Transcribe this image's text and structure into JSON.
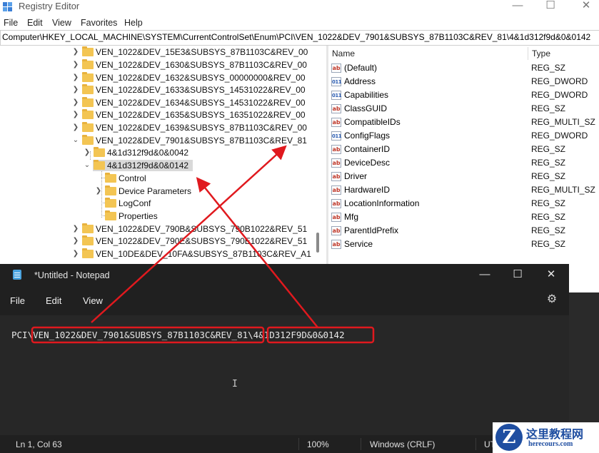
{
  "regedit": {
    "title": "Registry Editor",
    "menu": [
      "File",
      "Edit",
      "View",
      "Favorites",
      "Help"
    ],
    "address": "Computer\\HKEY_LOCAL_MACHINE\\SYSTEM\\CurrentControlSet\\Enum\\PCI\\VEN_1022&DEV_7901&SUBSYS_87B1103C&REV_81\\4&1d312f9d&0&0142",
    "tree": [
      "VEN_1022&DEV_15E3&SUBSYS_87B1103C&REV_00",
      "VEN_1022&DEV_1630&SUBSYS_87B1103C&REV_00",
      "VEN_1022&DEV_1632&SUBSYS_00000000&REV_00",
      "VEN_1022&DEV_1633&SUBSYS_14531022&REV_00",
      "VEN_1022&DEV_1634&SUBSYS_14531022&REV_00",
      "VEN_1022&DEV_1635&SUBSYS_16351022&REV_00",
      "VEN_1022&DEV_1639&SUBSYS_87B1103C&REV_00",
      "VEN_1022&DEV_7901&SUBSYS_87B1103C&REV_81",
      "4&1d312f9d&0&0042",
      "4&1d312f9d&0&0142",
      "Control",
      "Device Parameters",
      "LogConf",
      "Properties",
      "VEN_1022&DEV_790B&SUBSYS_790B1022&REV_51",
      "VEN_1022&DEV_790E&SUBSYS_790E1022&REV_51",
      "VEN_10DE&DEV_10FA&SUBSYS_87B1103C&REV_A1"
    ],
    "columns": {
      "name": "Name",
      "type": "Type"
    },
    "values": [
      {
        "name": "(Default)",
        "type": "REG_SZ",
        "icon": "string-value-icon"
      },
      {
        "name": "Address",
        "type": "REG_DWORD",
        "icon": "binary-value-icon"
      },
      {
        "name": "Capabilities",
        "type": "REG_DWORD",
        "icon": "binary-value-icon"
      },
      {
        "name": "ClassGUID",
        "type": "REG_SZ",
        "icon": "string-value-icon"
      },
      {
        "name": "CompatibleIDs",
        "type": "REG_MULTI_SZ",
        "icon": "string-value-icon"
      },
      {
        "name": "ConfigFlags",
        "type": "REG_DWORD",
        "icon": "binary-value-icon"
      },
      {
        "name": "ContainerID",
        "type": "REG_SZ",
        "icon": "string-value-icon"
      },
      {
        "name": "DeviceDesc",
        "type": "REG_SZ",
        "icon": "string-value-icon"
      },
      {
        "name": "Driver",
        "type": "REG_SZ",
        "icon": "string-value-icon"
      },
      {
        "name": "HardwareID",
        "type": "REG_MULTI_SZ",
        "icon": "string-value-icon"
      },
      {
        "name": "LocationInformation",
        "type": "REG_SZ",
        "icon": "string-value-icon"
      },
      {
        "name": "Mfg",
        "type": "REG_SZ",
        "icon": "string-value-icon"
      },
      {
        "name": "ParentIdPrefix",
        "type": "REG_SZ",
        "icon": "string-value-icon"
      },
      {
        "name": "Service",
        "type": "REG_SZ",
        "icon": "string-value-icon"
      }
    ]
  },
  "notepad": {
    "title": "*Untitled - Notepad",
    "menu": [
      "File",
      "Edit",
      "View"
    ],
    "text_prefix": "PCI\\",
    "text_device": "VEN_1022&DEV_7901&SUBSYS_87B1103C&REV_81",
    "text_sep": "\\",
    "text_instance": "4&1D312F9D&0&0142",
    "status": {
      "position": "Ln 1, Col 63",
      "zoom": "100%",
      "line_ending": "Windows (CRLF)",
      "encoding": "UT"
    }
  },
  "watermark": {
    "logo_letter": "Z",
    "site_name": "这里教程网",
    "url": "herecours.com"
  },
  "colors": {
    "annotation_red": "#e0191e",
    "folder_yellow": "#f3c553",
    "notepad_bg": "#272727"
  }
}
